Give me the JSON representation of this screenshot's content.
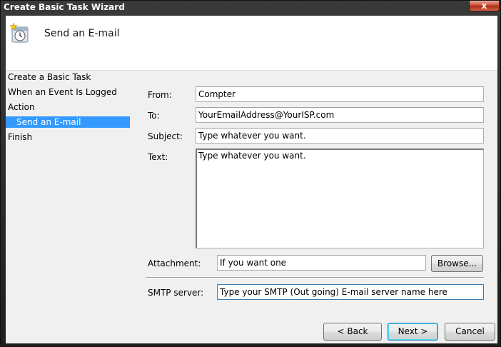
{
  "window": {
    "title": "Create Basic Task Wizard",
    "close_glyph": "x"
  },
  "header": {
    "icon": "task-scheduler-clock-icon",
    "title": "Send an E-mail"
  },
  "nav": {
    "items": [
      {
        "label": "Create a Basic Task"
      },
      {
        "label": "When an Event Is Logged"
      },
      {
        "label": "Action"
      },
      {
        "label": "Send an E-mail",
        "selected": true
      },
      {
        "label": "Finish"
      }
    ]
  },
  "form": {
    "from": {
      "label": "From:",
      "value": "Compter"
    },
    "to": {
      "label": "To:",
      "value": "YourEmailAddress@YourISP.com"
    },
    "subject": {
      "label": "Subject:",
      "value": "Type whatever you want."
    },
    "text": {
      "label": "Text:",
      "value": "Type whatever you want."
    },
    "attachment": {
      "label": "Attachment:",
      "value": "If you want one",
      "browse_label": "Browse..."
    },
    "smtp": {
      "label": "SMTP server:",
      "value": "Type  your SMTP (Out going) E-mail server name here"
    }
  },
  "buttons": {
    "back": "< Back",
    "next": "Next >",
    "cancel": "Cancel"
  },
  "colors": {
    "selection": "#3399ff",
    "close_button": "#c9452f"
  }
}
